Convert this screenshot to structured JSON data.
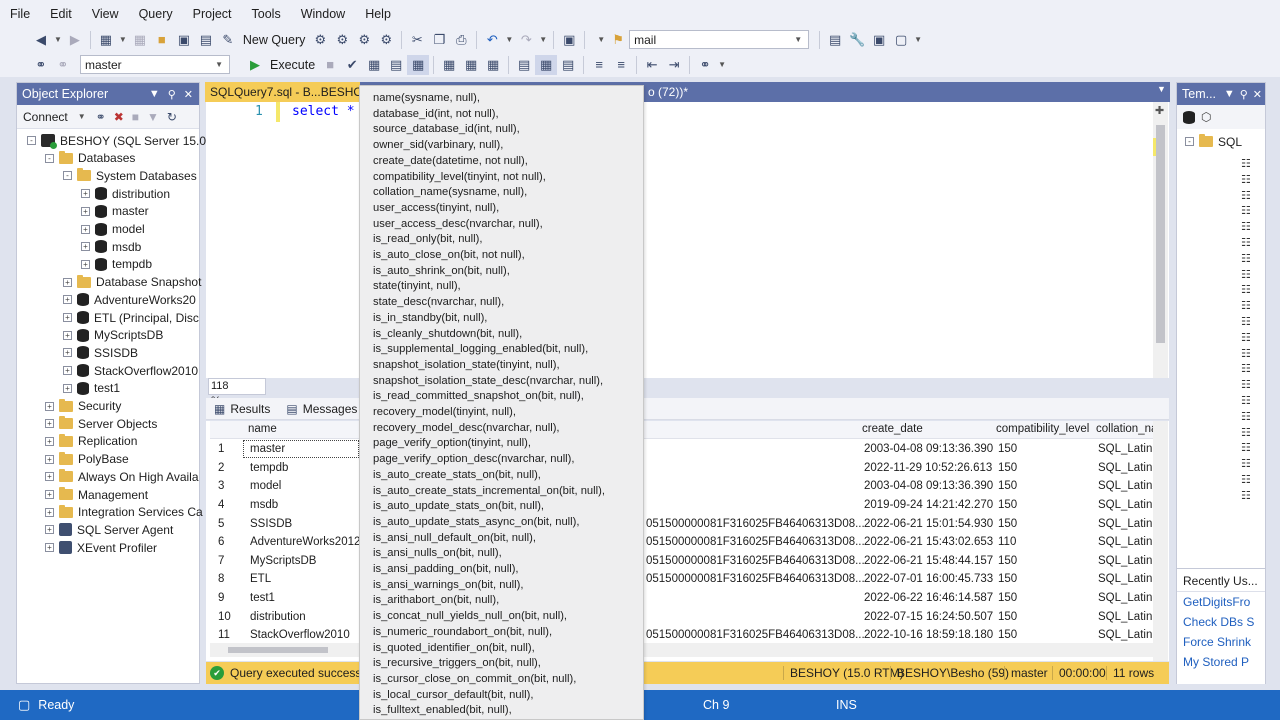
{
  "menu": [
    "File",
    "Edit",
    "View",
    "Query",
    "Project",
    "Tools",
    "Window",
    "Help"
  ],
  "toolbar": {
    "new_query": "New Query",
    "search_value": "mail",
    "database_select": "master",
    "execute": "Execute"
  },
  "object_explorer": {
    "title": "Object Explorer",
    "connect": "Connect",
    "nodes": [
      {
        "label": "BESHOY (SQL Server 15.0.2",
        "type": "server",
        "level": 0,
        "exp": "-"
      },
      {
        "label": "Databases",
        "type": "folder",
        "level": 1,
        "exp": "-"
      },
      {
        "label": "System Databases",
        "type": "folder",
        "level": 2,
        "exp": "-"
      },
      {
        "label": "distribution",
        "type": "db",
        "level": 3,
        "exp": "+"
      },
      {
        "label": "master",
        "type": "db",
        "level": 3,
        "exp": "+"
      },
      {
        "label": "model",
        "type": "db",
        "level": 3,
        "exp": "+"
      },
      {
        "label": "msdb",
        "type": "db",
        "level": 3,
        "exp": "+"
      },
      {
        "label": "tempdb",
        "type": "db",
        "level": 3,
        "exp": "+"
      },
      {
        "label": "Database Snapshot",
        "type": "folder",
        "level": 2,
        "exp": "+"
      },
      {
        "label": "AdventureWorks20",
        "type": "db",
        "level": 2,
        "exp": "+"
      },
      {
        "label": "ETL (Principal, Disc",
        "type": "db",
        "level": 2,
        "exp": "+"
      },
      {
        "label": "MyScriptsDB",
        "type": "db",
        "level": 2,
        "exp": "+"
      },
      {
        "label": "SSISDB",
        "type": "db",
        "level": 2,
        "exp": "+"
      },
      {
        "label": "StackOverflow2010",
        "type": "db",
        "level": 2,
        "exp": "+"
      },
      {
        "label": "test1",
        "type": "db",
        "level": 2,
        "exp": "+"
      },
      {
        "label": "Security",
        "type": "folder",
        "level": 1,
        "exp": "+"
      },
      {
        "label": "Server Objects",
        "type": "folder",
        "level": 1,
        "exp": "+"
      },
      {
        "label": "Replication",
        "type": "folder",
        "level": 1,
        "exp": "+"
      },
      {
        "label": "PolyBase",
        "type": "folder",
        "level": 1,
        "exp": "+"
      },
      {
        "label": "Always On High Availa",
        "type": "folder",
        "level": 1,
        "exp": "+"
      },
      {
        "label": "Management",
        "type": "folder",
        "level": 1,
        "exp": "+"
      },
      {
        "label": "Integration Services Ca",
        "type": "folder",
        "level": 1,
        "exp": "+"
      },
      {
        "label": "SQL Server Agent",
        "type": "gear",
        "level": 1,
        "exp": "+"
      },
      {
        "label": "XEvent Profiler",
        "type": "gear",
        "level": 1,
        "exp": "+"
      }
    ]
  },
  "editor": {
    "tab_active": "SQLQuery7.sql - B...BESHOY\\",
    "tab_other": "o (72))*",
    "line_number": "1",
    "code": "select *",
    "zoom": "118 %"
  },
  "results": {
    "tab_results": "Results",
    "tab_messages": "Messages",
    "headers": [
      "name",
      "create_date",
      "compatibility_level",
      "collation_na"
    ],
    "rows": [
      {
        "n": "1",
        "name": "master",
        "sid": "",
        "create": "2003-04-08 09:13:36.390",
        "compat": "150",
        "coll": "SQL_Latin"
      },
      {
        "n": "2",
        "name": "tempdb",
        "sid": "",
        "create": "2022-11-29 10:52:26.613",
        "compat": "150",
        "coll": "SQL_Latin"
      },
      {
        "n": "3",
        "name": "model",
        "sid": "",
        "create": "2003-04-08 09:13:36.390",
        "compat": "150",
        "coll": "SQL_Latin"
      },
      {
        "n": "4",
        "name": "msdb",
        "sid": "",
        "create": "2019-09-24 14:21:42.270",
        "compat": "150",
        "coll": "SQL_Latin"
      },
      {
        "n": "5",
        "name": "SSISDB",
        "sid": "051500000081F316025FB46406313D08...",
        "create": "2022-06-21 15:01:54.930",
        "compat": "150",
        "coll": "SQL_Latin"
      },
      {
        "n": "6",
        "name": "AdventureWorks2012",
        "sid": "051500000081F316025FB46406313D08...",
        "create": "2022-06-21 15:43:02.653",
        "compat": "110",
        "coll": "SQL_Latin"
      },
      {
        "n": "7",
        "name": "MyScriptsDB",
        "sid": "051500000081F316025FB46406313D08...",
        "create": "2022-06-21 15:48:44.157",
        "compat": "150",
        "coll": "SQL_Latin"
      },
      {
        "n": "8",
        "name": "ETL",
        "sid": "051500000081F316025FB46406313D08...",
        "create": "2022-07-01 16:00:45.733",
        "compat": "150",
        "coll": "SQL_Latin"
      },
      {
        "n": "9",
        "name": "test1",
        "sid": "",
        "create": "2022-06-22 16:46:14.587",
        "compat": "150",
        "coll": "SQL_Latin"
      },
      {
        "n": "10",
        "name": "distribution",
        "sid": "",
        "create": "2022-07-15 16:24:50.507",
        "compat": "150",
        "coll": "SQL_Latin"
      },
      {
        "n": "11",
        "name": "StackOverflow2010",
        "sid": "051500000081F316025FB46406313D08...",
        "create": "2022-10-16 18:59:18.180",
        "compat": "150",
        "coll": "SQL_Latin"
      }
    ]
  },
  "query_status": {
    "message": "Query executed successf",
    "server": "BESHOY (15.0 RTM)",
    "user": "BESHOY\\Besho (59)",
    "database": "master",
    "time": "00:00:00",
    "rows": "11 rows"
  },
  "statusbar": {
    "ready": "Ready",
    "ch": "Ch 9",
    "ins": "INS"
  },
  "right_panel": {
    "title": "Tem...",
    "root": "SQL",
    "recent_title": "Recently Us...",
    "recent": [
      "GetDigitsFro",
      "Check DBs S",
      "Force Shrink",
      "My Stored P"
    ]
  },
  "intellisense": [
    "name(sysname, null),",
    "database_id(int, not null),",
    "source_database_id(int, null),",
    "owner_sid(varbinary, null),",
    "create_date(datetime, not null),",
    "compatibility_level(tinyint, not null),",
    "collation_name(sysname, null),",
    "user_access(tinyint, null),",
    "user_access_desc(nvarchar, null),",
    "is_read_only(bit, null),",
    "is_auto_close_on(bit, not null),",
    "is_auto_shrink_on(bit, null),",
    "state(tinyint, null),",
    "state_desc(nvarchar, null),",
    "is_in_standby(bit, null),",
    "is_cleanly_shutdown(bit, null),",
    "is_supplemental_logging_enabled(bit, null),",
    "snapshot_isolation_state(tinyint, null),",
    "snapshot_isolation_state_desc(nvarchar, null),",
    "is_read_committed_snapshot_on(bit, null),",
    "recovery_model(tinyint, null),",
    "recovery_model_desc(nvarchar, null),",
    "page_verify_option(tinyint, null),",
    "page_verify_option_desc(nvarchar, null),",
    "is_auto_create_stats_on(bit, null),",
    "is_auto_create_stats_incremental_on(bit, null),",
    "is_auto_update_stats_on(bit, null),",
    "is_auto_update_stats_async_on(bit, null),",
    "is_ansi_null_default_on(bit, null),",
    "is_ansi_nulls_on(bit, null),",
    "is_ansi_padding_on(bit, null),",
    "is_ansi_warnings_on(bit, null),",
    "is_arithabort_on(bit, null),",
    "is_concat_null_yields_null_on(bit, null),",
    "is_numeric_roundabort_on(bit, null),",
    "is_quoted_identifier_on(bit, null),",
    "is_recursive_triggers_on(bit, null),",
    "is_cursor_close_on_commit_on(bit, null),",
    "is_local_cursor_default(bit, null),",
    "is_fulltext_enabled(bit, null),"
  ]
}
